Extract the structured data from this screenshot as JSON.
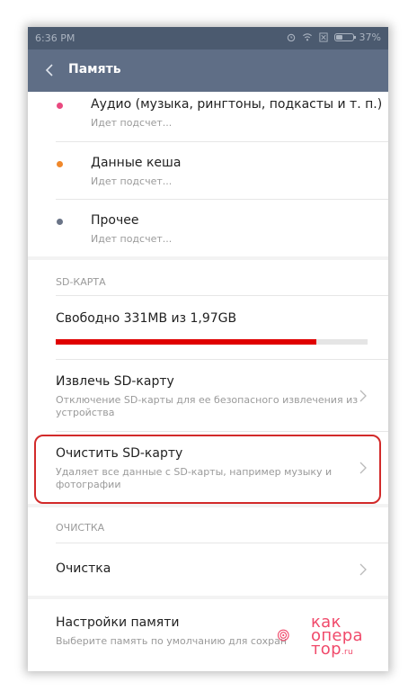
{
  "status_bar": {
    "time": "6:36 PM",
    "battery": "37%",
    "icons": [
      "alarm-icon",
      "wifi-icon",
      "sim-icon",
      "battery-icon"
    ]
  },
  "app_bar": {
    "title": "Память",
    "back_icon": "chevron-left-icon",
    "color": "#5f6e86"
  },
  "storage_items": [
    {
      "label": "Аудио (музыка, рингтоны, подкасты и т. п.)",
      "sub": "Идет подсчет...",
      "dot_color": "#e9497f"
    },
    {
      "label": "Данные кеша",
      "sub": "Идет подсчет...",
      "dot_color": "#f0882b"
    },
    {
      "label": "Прочее",
      "sub": "Идет подсчет...",
      "dot_color": "#6a7487"
    }
  ],
  "sd_section": {
    "header": "SD-КАРТА",
    "free_text": "Свободно 331MB из 1,97GB",
    "used_fraction": 0.837,
    "bar_color": "#e00000"
  },
  "eject": {
    "title": "Извлечь SD-карту",
    "sub_line1": "Отключение SD-карты для ее безопасного извлечения из",
    "sub_line2": "устройства"
  },
  "format": {
    "title": "Очистить SD-карту",
    "sub_line1": "Удаляет все данные с SD-карты, например музыку и",
    "sub_line2": "фотографии"
  },
  "cleanup_section": {
    "header": "ОЧИСТКА",
    "item": "Очистка"
  },
  "settings": {
    "title": "Настройки памяти",
    "sub": "Выберите память по умолчанию для сохран"
  },
  "watermark": {
    "line1": "как",
    "line2": "опера",
    "line3": "тор",
    "suffix": ".ru",
    "color": "#f04a6b"
  }
}
